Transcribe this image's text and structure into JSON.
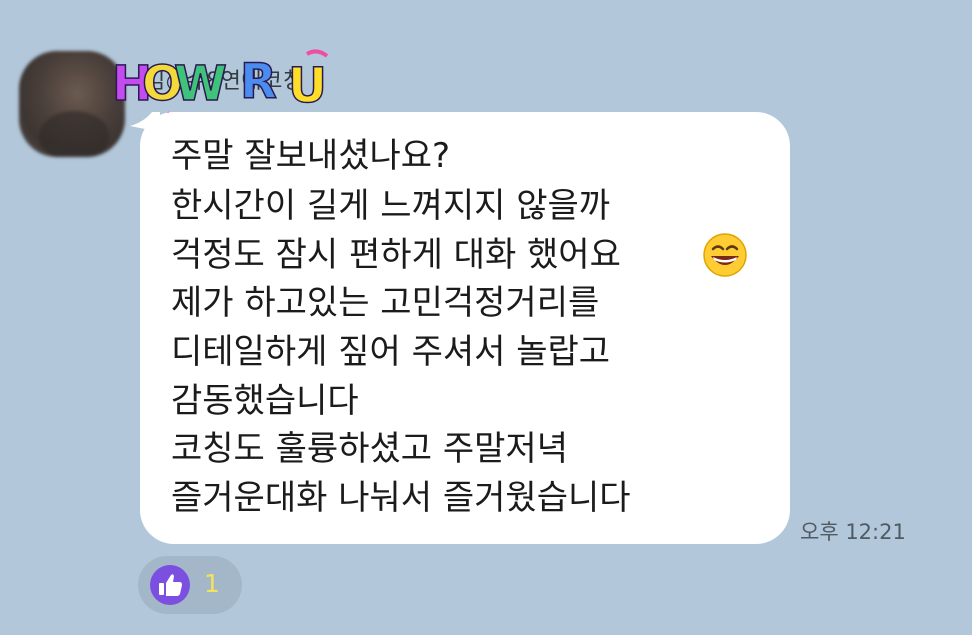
{
  "chat": {
    "sender_name": "김○슈8연애코칭",
    "sticker_text": "HOW R U",
    "message_lines": [
      "주말 잘보내셨나요?",
      "한시간이 길게 느껴지지 않을까",
      "걱정도 잠시 편하게 대화 했어요",
      "제가 하고있는 고민걱정거리를",
      "디테일하게 짚어 주셔서 놀랍고",
      "감동했습니다",
      "코칭도 훌륭하셨고 주말저녁",
      "즐거운대화 나눠서 즐거웠습니다"
    ],
    "emoji": "grinning-face-icon",
    "timestamp": "오후 12:21",
    "reaction": {
      "icon": "thumbs-up-icon",
      "count": "1",
      "icon_color": "#7b4fe0",
      "count_color": "#f2e35a"
    },
    "colors": {
      "background": "#b2c7da",
      "bubble": "#ffffff",
      "reaction_pill": "#a4b7c8"
    }
  }
}
